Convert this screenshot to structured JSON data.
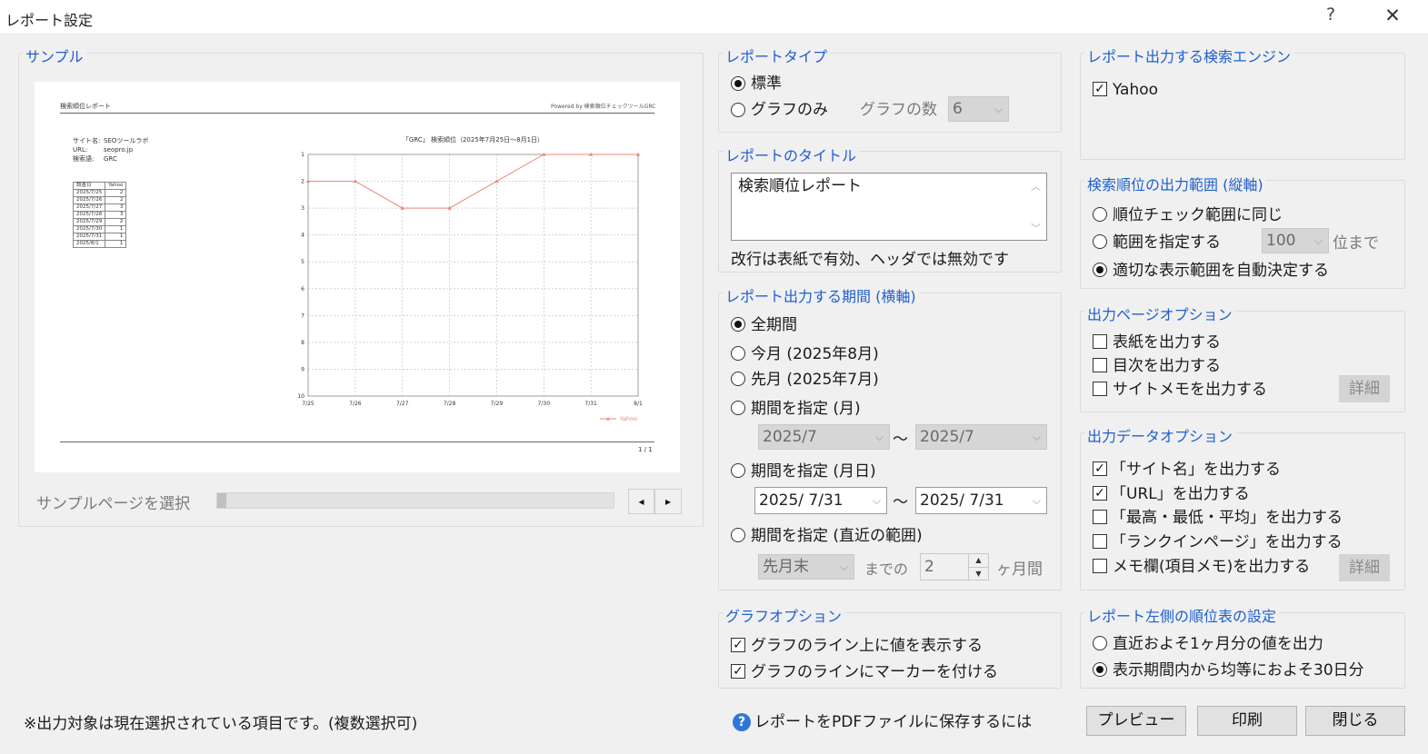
{
  "window": {
    "title": "レポート設定",
    "help": "?",
    "close": "✕"
  },
  "sample": {
    "label": "サンプル",
    "page_select_label": "サンプルページを選択",
    "report_title": "検索順位レポート",
    "powered": "Powered by 検索順位チェックツールGRC",
    "site_info": [
      "サイト名:",
      "SEOツールラボ",
      "URL:",
      "seopro.jp",
      "検索語:",
      "GRC"
    ],
    "table_headers": [
      "調査日",
      "Yahoo"
    ],
    "table_rows": [
      [
        "2025/7/25",
        "2"
      ],
      [
        "2025/7/26",
        "2"
      ],
      [
        "2025/7/27",
        "3"
      ],
      [
        "2025/7/28",
        "3"
      ],
      [
        "2025/7/29",
        "2"
      ],
      [
        "2025/7/30",
        "1"
      ],
      [
        "2025/7/31",
        "1"
      ],
      [
        "2025/8/1",
        "1"
      ]
    ],
    "page_num": "1 / 1",
    "nav_prev": "◂",
    "nav_next": "▸"
  },
  "chart_data": {
    "type": "line",
    "title": "「GRC」 検索順位（2025年7月25日～8月1日）",
    "categories": [
      "7/25",
      "7/26",
      "7/27",
      "7/28",
      "7/29",
      "7/30",
      "7/31",
      "8/1"
    ],
    "series": [
      {
        "name": "Yahoo",
        "values": [
          2,
          2,
          3,
          3,
          2,
          1,
          1,
          1
        ]
      }
    ],
    "y_ticks": [
      "1",
      "2",
      "3",
      "4",
      "5",
      "6",
      "7",
      "8",
      "9",
      "10"
    ],
    "ylim": [
      1,
      10
    ],
    "y_inverted": true,
    "grid": true,
    "color": "#e8897a",
    "legend": "bottom-right"
  },
  "report_type": {
    "label": "レポートタイプ",
    "standard": "標準",
    "graph_only": "グラフのみ",
    "graph_count_label": "グラフの数",
    "graph_count": "6"
  },
  "report_title": {
    "label": "レポートのタイトル",
    "value": "検索順位レポート",
    "note": "改行は表紙で有効、ヘッダでは無効です"
  },
  "period": {
    "label": "レポート出力する期間 (横軸)",
    "all": "全期間",
    "this_month": "今月 (2025年8月)",
    "last_month": "先月 (2025年7月)",
    "by_month": "期間を指定 (月)",
    "month_from": "2025/7",
    "month_to": "2025/7",
    "tilde": "～",
    "by_day": "期間を指定 (月日)",
    "day_from": "2025/  7/31",
    "day_to": "2025/  7/31",
    "recent": "期間を指定 (直近の範囲)",
    "recent_base": "先月末",
    "until": "までの",
    "months": "2",
    "months_unit": "ヶ月間"
  },
  "graph_options": {
    "label": "グラフオプション",
    "show_values": "グラフのライン上に値を表示する",
    "show_markers": "グラフのラインにマーカーを付ける"
  },
  "engines": {
    "label": "レポート出力する検索エンジン",
    "yahoo": "Yahoo"
  },
  "rank_range": {
    "label": "検索順位の出力範囲 (縦軸)",
    "same": "順位チェック範囲に同じ",
    "specify": "範囲を指定する",
    "specify_value": "100",
    "specify_unit": "位まで",
    "auto": "適切な表示範囲を自動決定する"
  },
  "page_options": {
    "label": "出力ページオプション",
    "cover": "表紙を出力する",
    "toc": "目次を出力する",
    "site_memo": "サイトメモを出力する",
    "detail": "詳細"
  },
  "data_options": {
    "label": "出力データオプション",
    "site_name": "「サイト名」を出力する",
    "url": "「URL」を出力する",
    "high_low_avg": "「最高・最低・平均」を出力する",
    "rank_in_page": "「ランクインページ」を出力する",
    "memo": "メモ欄(項目メモ)を出力する",
    "detail": "詳細"
  },
  "left_table": {
    "label": "レポート左側の順位表の設定",
    "recent_month": "直近およそ1ヶ月分の値を出力",
    "even_30": "表示期間内から均等におよそ30日分"
  },
  "footer": {
    "note": "※出力対象は現在選択されている項目です。(複数選択可)",
    "pdf_help": "レポートをPDFファイルに保存するには",
    "preview": "プレビュー",
    "print": "印刷",
    "close": "閉じる"
  }
}
